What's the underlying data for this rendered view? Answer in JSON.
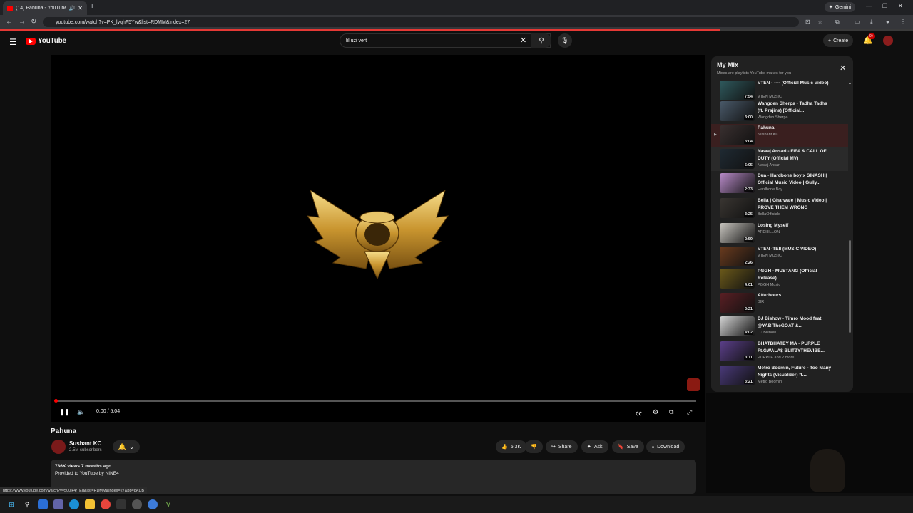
{
  "browser": {
    "tab_title": "(14) Pahuna - YouTube",
    "new_tab": "+",
    "gemini_label": "Gemini",
    "url": "youtube.com/watch?v=PK_lyqhF5Yw&list=RDMM&index=27"
  },
  "header": {
    "logo_text": "YouTube",
    "search_value": "lil uzi vert",
    "create_label": "Create",
    "notification_count": "9+"
  },
  "player": {
    "time": "0:00 / 5:04"
  },
  "video": {
    "title": "Pahuna",
    "channel": "Sushant KC",
    "subscribers": "2.5M subscribers",
    "likes": "5.3K",
    "share": "Share",
    "ask": "Ask",
    "save": "Save",
    "download": "Download",
    "stats": "736K views  7 months ago",
    "provided": "Provided to YouTube by NINE4"
  },
  "status_url": "https://www.youtube.com/watch?v=500ik4r_Eg&list=RDMM&index=27&pp=8AUB",
  "mix": {
    "title": "My Mix",
    "subtitle": "Mixes are playlists YouTube makes for you",
    "items": [
      {
        "title": "VTEN - ---- (Official Music Video)",
        "channel": "VTEN MUSIC",
        "duration": "7:54",
        "color": "#2f5a5e"
      },
      {
        "title": "Wangden Sherpa - Tadha Tadha (ft. Prajina) [Official...",
        "channel": "Wangden Sherpa",
        "duration": "3:00",
        "color": "#4a5a6a"
      },
      {
        "title": "Pahuna",
        "channel": "Sushant KC",
        "duration": "3:04",
        "color": "#3a3030"
      },
      {
        "title": "Nawaj Ansari - FIFA & CALL OF DUTY (Official MV)",
        "channel": "Nawaj Ansari",
        "duration": "5:05",
        "color": "#1f2a33"
      },
      {
        "title": "Dua - Hardbone boy x SINASH | Official Music Video | Gully...",
        "channel": "Hardbone Boy",
        "duration": "2:33",
        "color": "#b98bc9"
      },
      {
        "title": "Bella | Gharwale | Music Video | PROVE THEM WRONG",
        "channel": "BellaOfficials",
        "duration": "3:25",
        "color": "#3a3632"
      },
      {
        "title": "Losing Myself",
        "channel": "APDHILLON",
        "duration": "2:59",
        "color": "#c9c6c0"
      },
      {
        "title": "VTEN -TEII (MUSIC VIDEO)",
        "channel": "VTEN MUSIC",
        "duration": "2:26",
        "color": "#6a3b1e"
      },
      {
        "title": "PGGH - MUSTANG (Official Release)",
        "channel": "PGGH Music",
        "duration": "4:01",
        "color": "#6c5a1a"
      },
      {
        "title": "Afterhours",
        "channel": "BIR",
        "duration": "2:21",
        "color": "#5a1f24"
      },
      {
        "title": "DJ Bishow - Timro Mood feat. @YABITheGOAT &...",
        "channel": "DJ Bishow",
        "duration": "4:02",
        "color": "#d5d5d5"
      },
      {
        "title": "BHATBHATEY MA - PURPLE Ft.GWALA$ BLITZYTHEVIBE...",
        "channel": "PURPLE and 2 more",
        "duration": "3:11",
        "color": "#5b3f8a"
      },
      {
        "title": "Metro Boomin, Future - Too Many Nights (Visualizer) ft....",
        "channel": "Metro Boomin",
        "duration": "3:21",
        "color": "#4a3a7a"
      }
    ]
  }
}
